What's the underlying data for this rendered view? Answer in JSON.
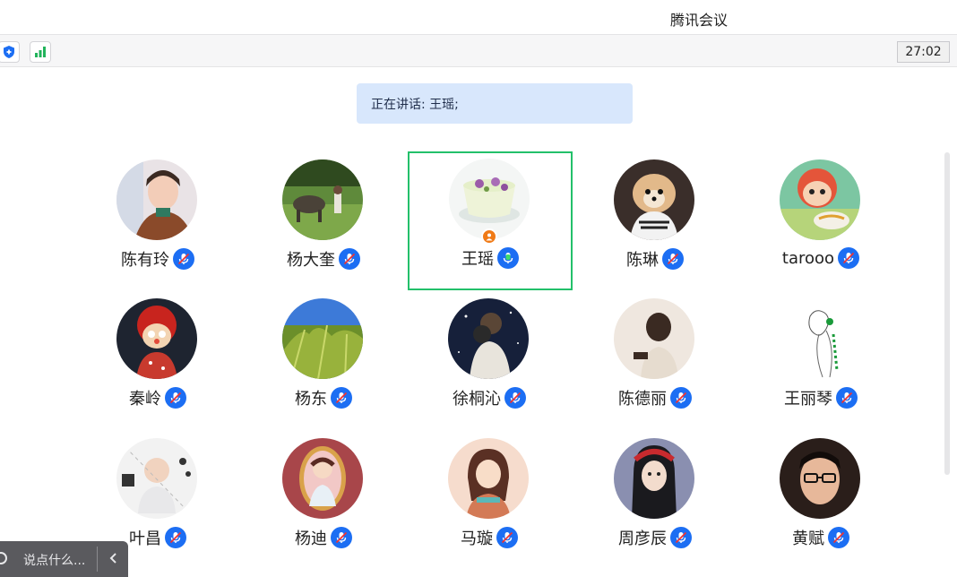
{
  "window": {
    "title": "腾讯会议"
  },
  "toolbar": {
    "timer": "27:02"
  },
  "speaking": {
    "label": "正在讲话:",
    "names": "王瑶;"
  },
  "chat": {
    "placeholder": "说点什么..."
  },
  "colors": {
    "accent": "#1c6ef3",
    "active_border": "#23c06a",
    "banner": "#d8e7fc",
    "host_badge": "#f07a16"
  },
  "participants": [
    {
      "name": "陈有玲",
      "mic": "muted"
    },
    {
      "name": "杨大奎",
      "mic": "muted"
    },
    {
      "name": "王瑶",
      "mic": "speaking",
      "host": true,
      "active": true
    },
    {
      "name": "陈琳",
      "mic": "muted"
    },
    {
      "name": "tarooo",
      "mic": "muted"
    },
    {
      "name": "秦岭",
      "mic": "muted"
    },
    {
      "name": "杨东",
      "mic": "muted"
    },
    {
      "name": "徐桐沁",
      "mic": "muted"
    },
    {
      "name": "陈德丽",
      "mic": "muted"
    },
    {
      "name": "王丽琴",
      "mic": "muted"
    },
    {
      "name": "叶昌",
      "mic": "muted"
    },
    {
      "name": "杨迪",
      "mic": "muted"
    },
    {
      "name": "马璇",
      "mic": "muted"
    },
    {
      "name": "周彦辰",
      "mic": "muted"
    },
    {
      "name": "黄赋",
      "mic": "muted"
    }
  ]
}
